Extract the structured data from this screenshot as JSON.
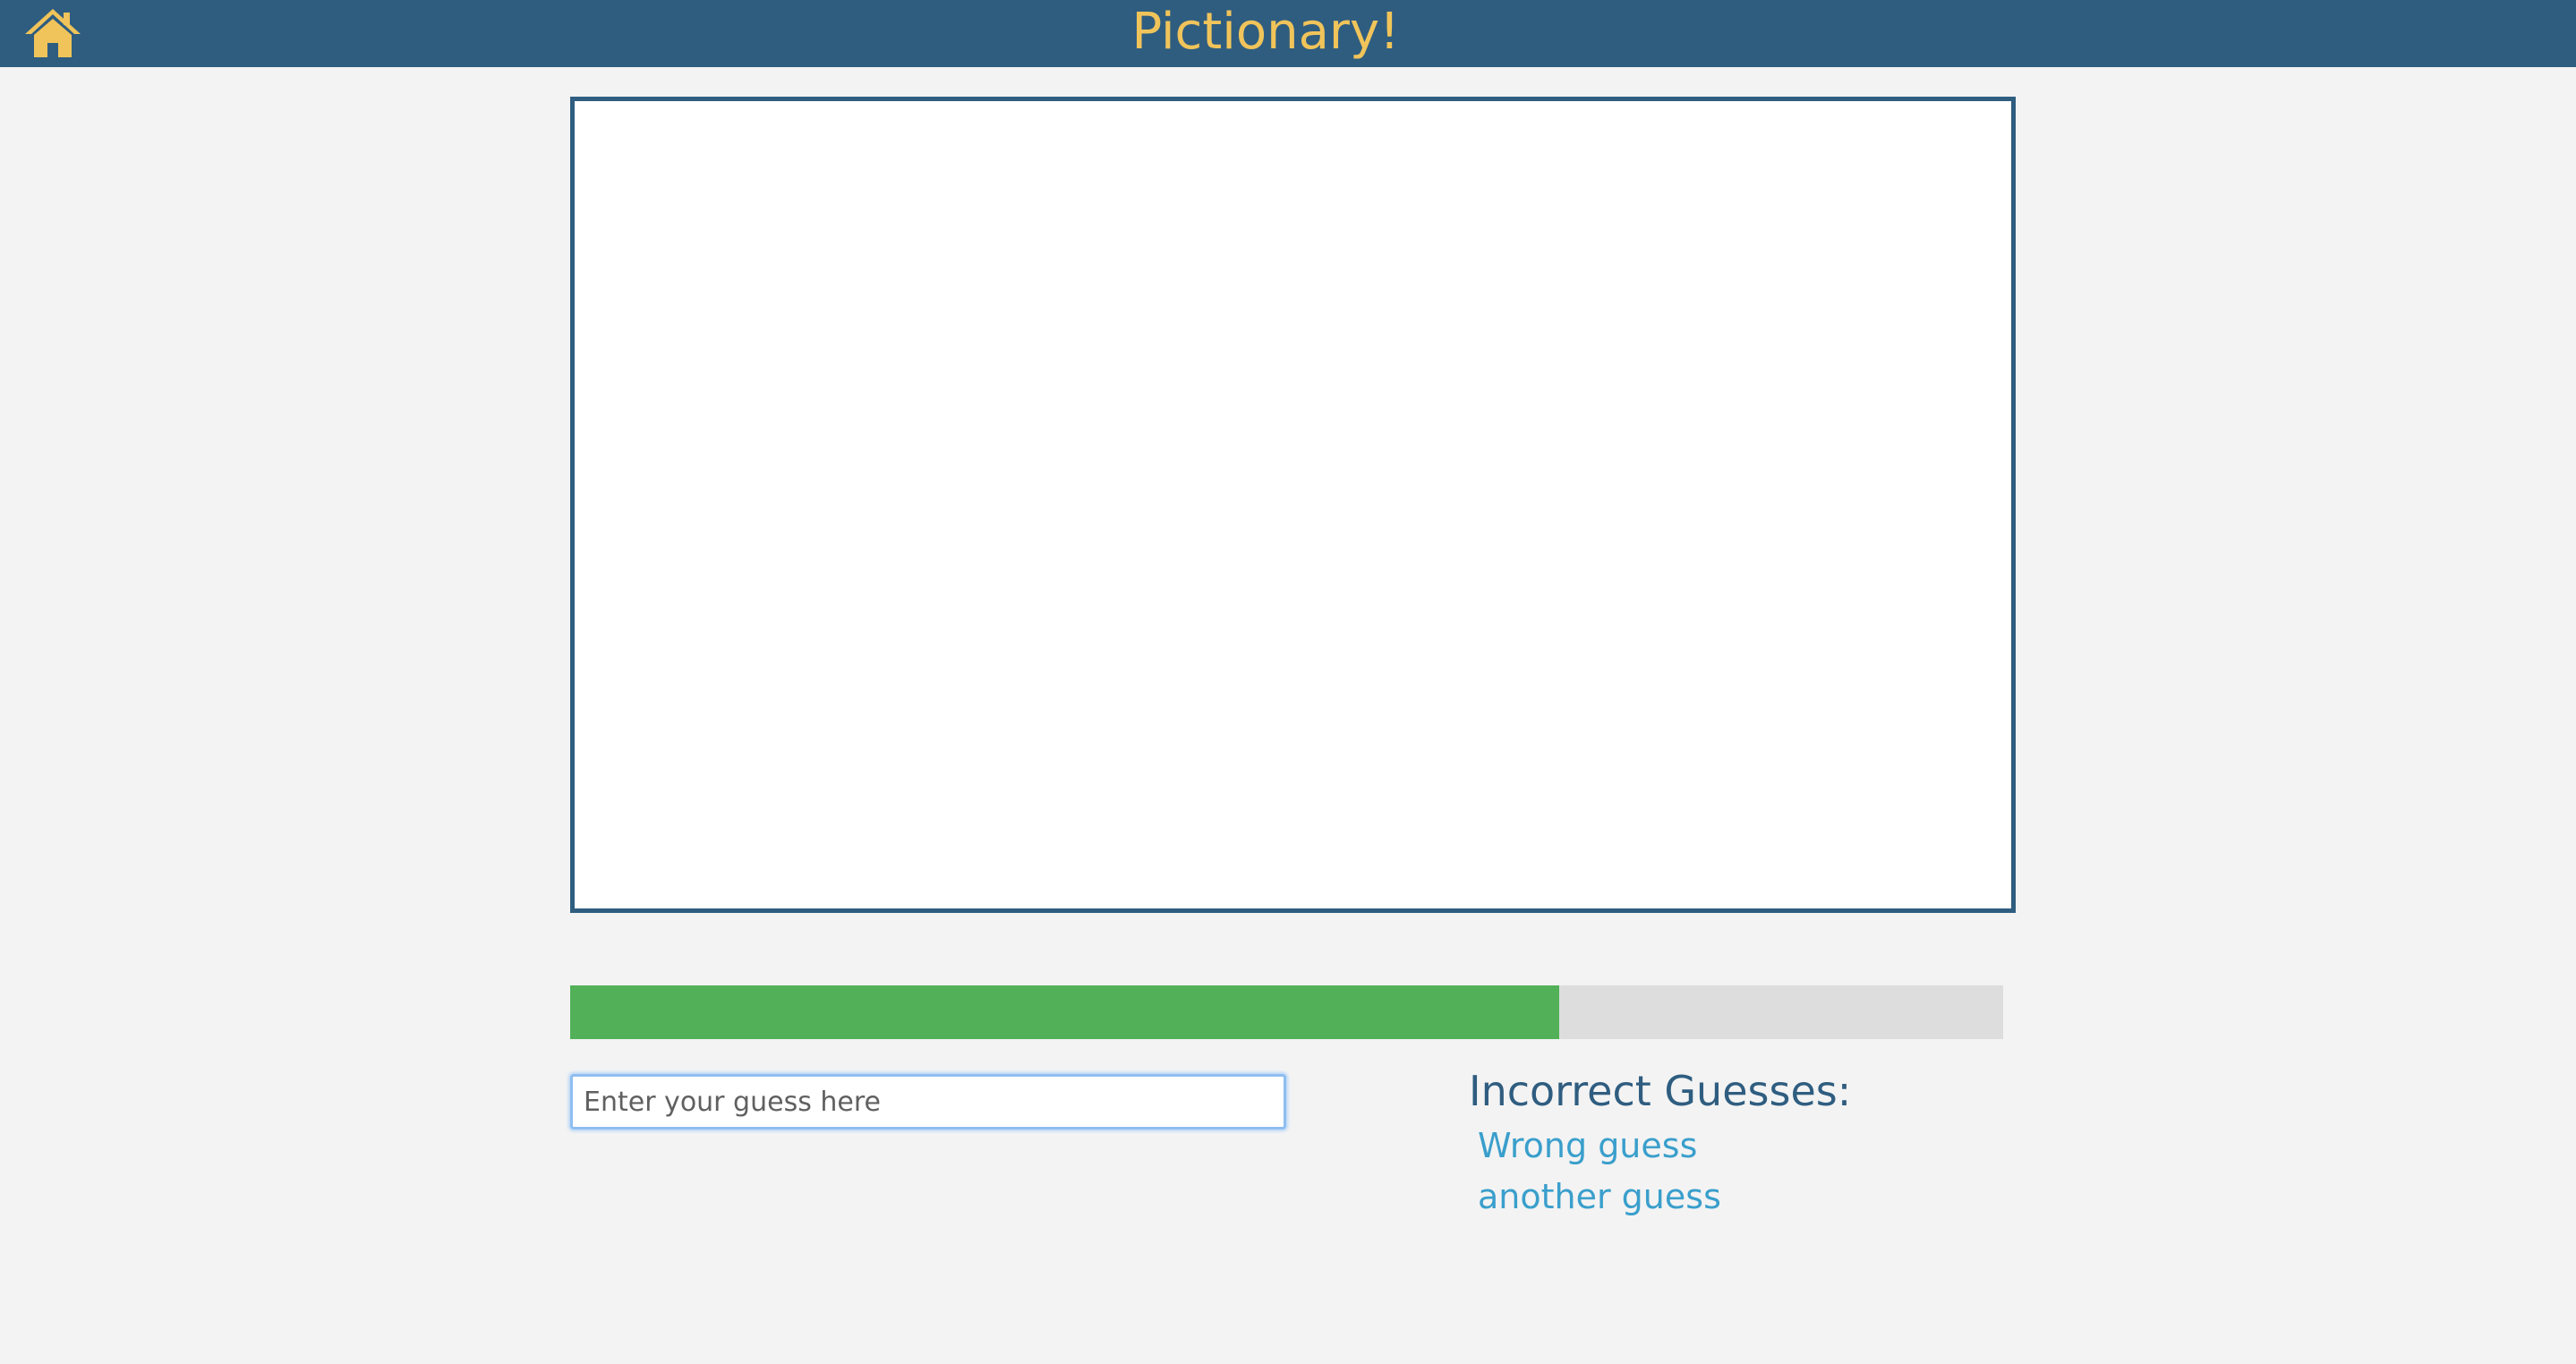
{
  "header": {
    "title": "Pictionary!",
    "home_icon": "home-icon",
    "background": "#2f5d80",
    "title_color": "#f0c45a"
  },
  "canvas": {
    "border_color": "#2f5d80",
    "background": "#ffffff"
  },
  "timer": {
    "progress_fraction": 0.69,
    "fill_color": "#52b058",
    "track_color": "#dddddd"
  },
  "guess_input": {
    "placeholder": "Enter your guess here",
    "value": ""
  },
  "incorrect_guesses": {
    "title": "Incorrect Guesses:",
    "items": [
      "Wrong guess",
      "another guess"
    ],
    "title_color": "#2f5d80",
    "item_color": "#3a9fcc"
  }
}
